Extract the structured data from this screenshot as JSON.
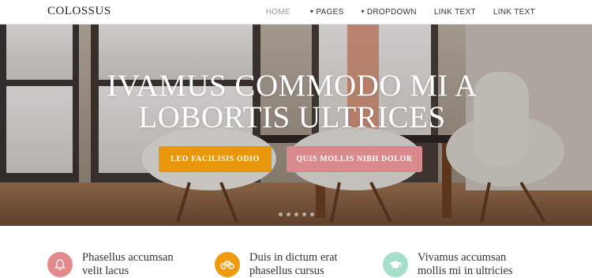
{
  "brand": "COLOSSUS",
  "nav": {
    "home": "HOME",
    "pages": "PAGES",
    "dropdown": "DROPDOWN",
    "link1": "LINK TEXT",
    "link2": "LINK TEXT"
  },
  "hero": {
    "title_line1": "IVAMUS COMMODO MI A",
    "title_line2": "LOBORTIS ULTRICES",
    "button1": "LEO FACILISIS ODIO",
    "button2": "QUIS MOLLIS NIBH DOLOR",
    "button1_color": "#e8960c",
    "button2_color": "#d98a8d"
  },
  "features": [
    {
      "line1": "Phasellus accumsan",
      "line2": "velit lacus",
      "icon": "bell-icon",
      "color": "#e28a8c"
    },
    {
      "line1": "Duis in dictum erat",
      "line2": "phasellus cursus",
      "icon": "bicycle-icon",
      "color": "#f09a0e"
    },
    {
      "line1": "Vivamus accumsan",
      "line2": "mollis mi in ultricies",
      "icon": "graduation-cap-icon",
      "color": "#a6dfc9"
    }
  ]
}
